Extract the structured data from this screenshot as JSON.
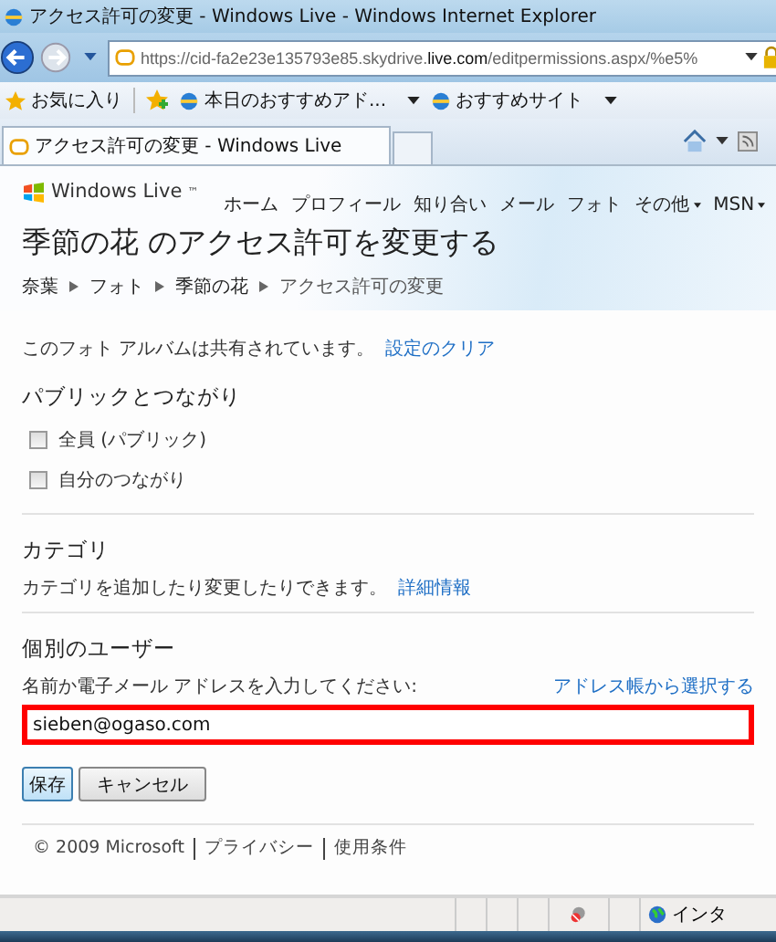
{
  "window": {
    "title": "アクセス許可の変更 - Windows Live - Windows Internet Explorer"
  },
  "address_bar": {
    "url_prefix": "https://cid-fa2e23e135793e85.skydrive.",
    "url_domain": "live.com",
    "url_suffix": "/editpermissions.aspx/%e5%"
  },
  "favorites_bar": {
    "favorites": "お気に入り",
    "items": [
      "本日のおすすめアド...",
      "おすすめサイト"
    ]
  },
  "tabs": [
    {
      "kind": "page",
      "label": "アクセス許可の変更 - Windows Live",
      "selected": true
    },
    {
      "kind": "new",
      "selected": false
    }
  ],
  "site": {
    "logo": "Windows Live",
    "logo_mark": "™",
    "nav": [
      {
        "label": "ホーム",
        "menu": false
      },
      {
        "label": "プロフィール",
        "menu": false
      },
      {
        "label": "知り合い",
        "menu": false
      },
      {
        "label": "メール",
        "menu": false
      },
      {
        "label": "フォト",
        "menu": false
      },
      {
        "label": "その他",
        "menu": true
      },
      {
        "label": "MSN",
        "menu": true
      }
    ]
  },
  "page": {
    "title": "季節の花 のアクセス許可を変更する",
    "breadcrumb": [
      "奈葉",
      "フォト",
      "季節の花",
      "アクセス許可の変更"
    ],
    "shared_text": "このフォト アルバムは共有されています。",
    "clear_link": "設定のクリア",
    "public_heading": "パブリックとつながり",
    "options": [
      {
        "label": "全員 (パブリック)",
        "checked": false
      },
      {
        "label": "自分のつながり",
        "checked": false
      }
    ],
    "category_heading": "カテゴリ",
    "category_text": "カテゴリを追加したり変更したりできます。",
    "category_link": "詳細情報",
    "users_heading": "個別のユーザー",
    "users_label": "名前か電子メール アドレスを入力してください:",
    "address_book_link": "アドレス帳から選択する",
    "user_input": {
      "value": "sieben@ogaso.com",
      "highlighted": true
    },
    "buttons": [
      {
        "label": "保存",
        "primary": true
      },
      {
        "label": "キャンセル",
        "primary": false
      }
    ]
  },
  "footer": {
    "copyright": "© 2009 Microsoft",
    "links": [
      "プライバシー",
      "使用条件"
    ]
  },
  "status_bar": {
    "zone": "インタ"
  }
}
